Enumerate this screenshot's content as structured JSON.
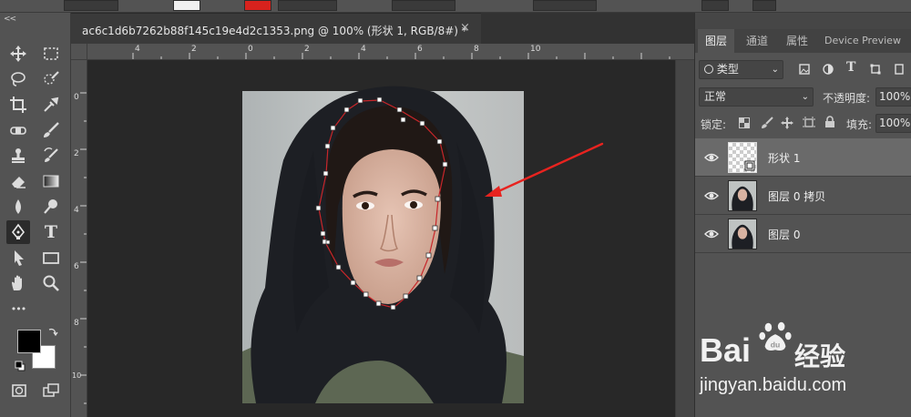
{
  "document": {
    "tab_title": "ac6c1d6b7262b88f145c19e4d2c1353.png @ 100% (形状 1, RGB/8#) *",
    "close_glyph": "×",
    "ruler_h": [
      "4",
      "2",
      "0",
      "2",
      "4",
      "6",
      "8",
      "10"
    ],
    "ruler_v": [
      "0",
      "2",
      "4",
      "6",
      "8",
      "10"
    ]
  },
  "toolbar": {
    "collapse_glyph": "<<",
    "tools": [
      "move-icon",
      "marquee-icon",
      "lasso-icon",
      "quick-select-icon",
      "crop-icon",
      "eyedropper-icon",
      "healing-icon",
      "brush-icon",
      "stamp-icon",
      "history-brush-icon",
      "eraser-icon",
      "gradient-icon",
      "blur-icon",
      "dodge-icon",
      "pen-icon",
      "type-icon",
      "path-select-icon",
      "rectangle-icon",
      "hand-icon",
      "zoom-icon",
      "more-icon"
    ],
    "more_glyph": "•••",
    "type_glyph": "T",
    "foreground_color": "#000000",
    "background_color": "#ffffff"
  },
  "panel": {
    "tabs": [
      "图层",
      "通道",
      "属性",
      "Device Preview"
    ],
    "filter_label": "类型",
    "blend_mode": "正常",
    "opacity_label": "不透明度:",
    "opacity_value": "100%",
    "lock_label": "锁定:",
    "fill_label": "填充:",
    "fill_value": "100%",
    "type_glyph": "T",
    "layers": [
      {
        "name": "形状 1",
        "selected": true
      },
      {
        "name": "图层 0 拷贝",
        "selected": false
      },
      {
        "name": "图层 0",
        "selected": false
      }
    ]
  },
  "watermark": {
    "brand": "Bai",
    "brand_tail": "经验",
    "url": "jingyan.baidu.com"
  },
  "colors": {
    "annotation_arrow": "#e8231f",
    "path_outline": "#c8262a"
  }
}
